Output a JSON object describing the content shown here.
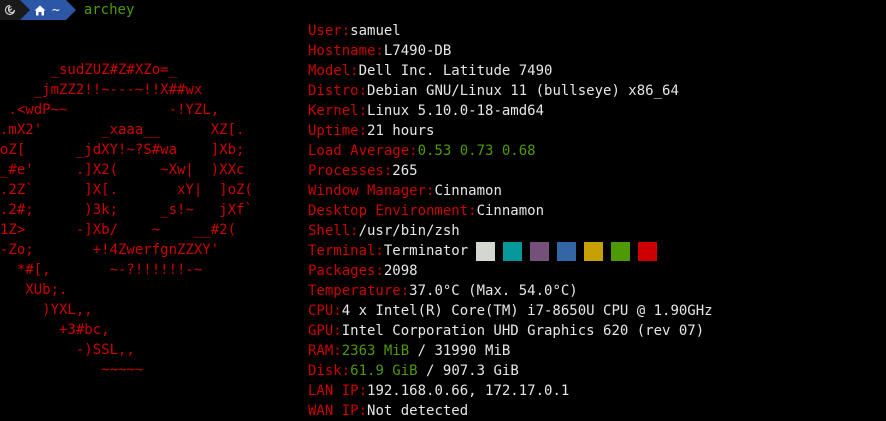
{
  "prompt": {
    "os_icon": "debian-swirl",
    "home_icon": "home-icon",
    "dir": "~",
    "command": "archey"
  },
  "logo": {
    "lines": [
      "      _sudZUZ#Z#XZo=_",
      "    _jmZZ2!!~---~!!X##wx",
      " .<wdP~~            -!YZL,",
      ".mX2'       _xaaa__      XZ[.",
      "oZ[      _jdXY!~?S#wa    ]Xb;",
      "_#e'     .]X2(     ~Xw|  )XXc",
      ".2Z`      ]X[.       xY|  ]oZ(",
      ".2#;      )3k;     _s!~   jXf`",
      "1Z>      -]Xb/    ~    __#2(",
      "-Zo;       +!4ZwerfgnZZXY'",
      "  *#[,       ~-?!!!!!!-~",
      "   XUb;.",
      "     )YXL,,",
      "       +3#bc,",
      "         -)SSL,,",
      "            ~~~~~"
    ]
  },
  "info": [
    {
      "key": "User:",
      "value": "samuel"
    },
    {
      "key": "Hostname:",
      "value": "L7490-DB"
    },
    {
      "key": "Model:",
      "value": "Dell Inc. Latitude 7490"
    },
    {
      "key": "Distro:",
      "value": "Debian GNU/Linux 11 (bullseye) x86_64"
    },
    {
      "key": "Kernel:",
      "value": "Linux 5.10.0-18-amd64"
    },
    {
      "key": "Uptime:",
      "value": "21 hours"
    },
    {
      "key": "Load Average:",
      "value": "0.53 0.73 0.68"
    },
    {
      "key": "Processes:",
      "value": "265"
    },
    {
      "key": "Window Manager:",
      "value": "Cinnamon"
    },
    {
      "key": "Desktop Environment:",
      "value": "Cinnamon"
    },
    {
      "key": "Shell:",
      "value": "/usr/bin/zsh"
    },
    {
      "key": "Terminal:",
      "value": "Terminator"
    },
    {
      "key": "Packages:",
      "value": "2098"
    },
    {
      "key": "Temperature:",
      "value": "37.0°C (Max. 54.0°C)"
    },
    {
      "key": "CPU:",
      "value": "4 x Intel(R) Core(TM) i7-8650U CPU @ 1.90GHz"
    },
    {
      "key": "GPU:",
      "value": "Intel Corporation UHD Graphics 620 (rev 07)"
    },
    {
      "key": "RAM:",
      "used": "2363 MiB",
      "sep": " / ",
      "total": "31990 MiB"
    },
    {
      "key": "Disk:",
      "used": "61.9 GiB",
      "sep": " / ",
      "total": "907.3 GiB"
    },
    {
      "key": "LAN IP:",
      "value": "192.168.0.66, 172.17.0.1"
    },
    {
      "key": "WAN IP:",
      "value": "Not detected"
    }
  ],
  "terminal_palette": [
    "#d3d7cf",
    "#06989a",
    "#75507b",
    "#3465a4",
    "#c4a000",
    "#4e9a06",
    "#cc0000"
  ],
  "colors": {
    "key": "#cc0000",
    "value": "#e6e6e6",
    "accent_green": "#4e9a06",
    "background": "#000000",
    "prompt_dir_bg": "#2b57a6"
  }
}
